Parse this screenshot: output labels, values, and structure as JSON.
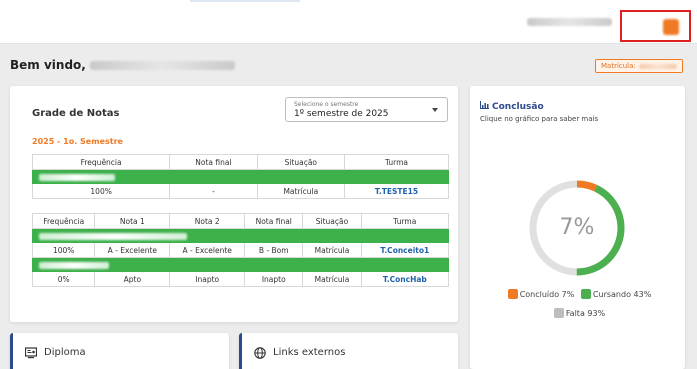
{
  "header": {
    "user_name_redacted": true
  },
  "welcome": {
    "prefix": "Bem vindo,",
    "matricula_label": "Matrícula:"
  },
  "grades": {
    "title": "Grade de Notas",
    "semester_select": {
      "label": "Selecione o semestre",
      "value": "1º semestre de 2025"
    },
    "semester_title": "2025 - 1o. Semestre",
    "table1": {
      "headers": [
        "Frequência",
        "Nota final",
        "Situação",
        "Turma"
      ],
      "row": [
        "100%",
        "-",
        "Matrícula",
        "T.TESTE15"
      ]
    },
    "table2": {
      "headers": [
        "Frequência",
        "Nota 1",
        "Nota 2",
        "Nota final",
        "Situação",
        "Turma"
      ],
      "rows": [
        [
          "100%",
          "A - Excelente",
          "A - Excelente",
          "B - Bom",
          "Matrícula",
          "T.Conceito1"
        ],
        [
          "0%",
          "Apto",
          "Inapto",
          "Inapto",
          "Matrícula",
          "T.ConcHab"
        ]
      ]
    }
  },
  "conclusion": {
    "icon": "bar-chart-icon",
    "title": "Conclusão",
    "subtitle": "Clique no gráfico para saber mais",
    "center_label": "7%",
    "legend": [
      {
        "label": "Concluído 7%",
        "color": "#f07a24"
      },
      {
        "label": "Cursando 43%",
        "color": "#4caf50"
      },
      {
        "label": "Falta 93%",
        "color": "#bdbdbd"
      }
    ],
    "segments": {
      "concluido": 7,
      "cursando": 43,
      "falta": 50
    }
  },
  "bottom": {
    "diploma": {
      "label": "Diploma",
      "icon": "diploma-icon"
    },
    "links": {
      "label": "Links externos",
      "icon": "globe-icon"
    }
  },
  "colors": {
    "accent": "#f07a24",
    "green": "#3cb04a",
    "navy": "#2e4a8e"
  }
}
